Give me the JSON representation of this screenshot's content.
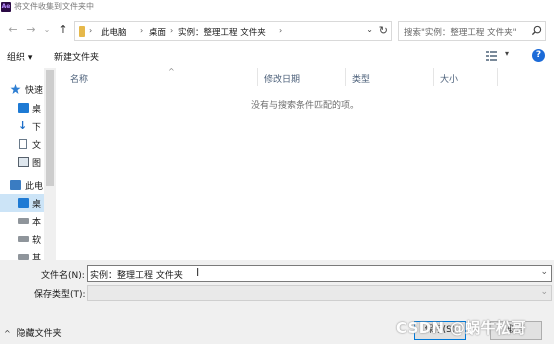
{
  "window": {
    "app_icon_text": "Ae",
    "title": "将文件收集到文件夹中"
  },
  "nav": {
    "breadcrumbs": [
      "此电脑",
      "桌面",
      "实例：整理工程 文件夹"
    ],
    "search_placeholder": "搜索\"实例：整理工程 文件夹\""
  },
  "toolbar": {
    "organize_label": "组织 ▾",
    "new_folder_label": "新建文件夹"
  },
  "sidebar": {
    "items": [
      {
        "label": "快速",
        "icon": "star-icon"
      },
      {
        "label": "桌",
        "icon": "desktop-icon"
      },
      {
        "label": "下",
        "icon": "download-icon"
      },
      {
        "label": "文",
        "icon": "document-icon"
      },
      {
        "label": "图",
        "icon": "picture-icon"
      },
      {
        "label": "此电",
        "icon": "computer-icon"
      },
      {
        "label": "桌",
        "icon": "desktop-icon"
      },
      {
        "label": "本",
        "icon": "drive-icon"
      },
      {
        "label": "软",
        "icon": "drive-icon"
      },
      {
        "label": "其",
        "icon": "drive-icon"
      }
    ]
  },
  "filelist": {
    "columns": [
      "名称",
      "修改日期",
      "类型",
      "大小"
    ],
    "empty_message": "没有与搜索条件匹配的项。"
  },
  "form": {
    "filename_label": "文件名(N):",
    "filename_value": "实例：整理工程 文件夹",
    "savetype_label": "保存类型(T):",
    "savetype_value": ""
  },
  "footer": {
    "hide_folders_label": "隐藏文件夹",
    "save_button": "保存(S)",
    "cancel_button": "取消"
  },
  "watermark": "CSDN @蜗牛松哥"
}
